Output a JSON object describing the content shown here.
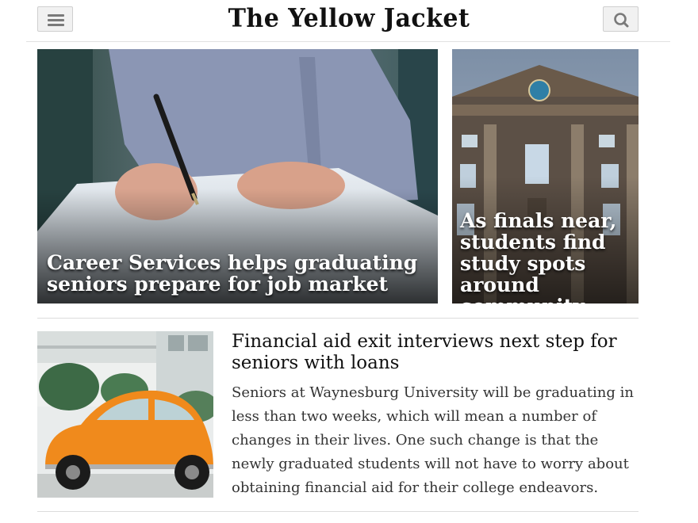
{
  "header": {
    "logo_text": "The Yellow Jacket",
    "menu_icon": "hamburger-menu-icon",
    "search_icon": "magnifier-search-icon"
  },
  "featured": [
    {
      "title": "Career Services helps graduating seniors prepare for job market"
    },
    {
      "title": "As finals near, students find study spots around community"
    }
  ],
  "article": {
    "title": "Financial aid exit interviews next step for seniors with loans",
    "excerpt": "Seniors at Waynesburg University will be graduating in less than two weeks, which will mean a number of changes in their lives. One such change is that the newly graduated students will not have to worry about obtaining financial aid for their college endeavors."
  },
  "colors": {
    "accent_car": "#f08a1c",
    "rule": "#dcdcdc",
    "text": "#111111"
  }
}
